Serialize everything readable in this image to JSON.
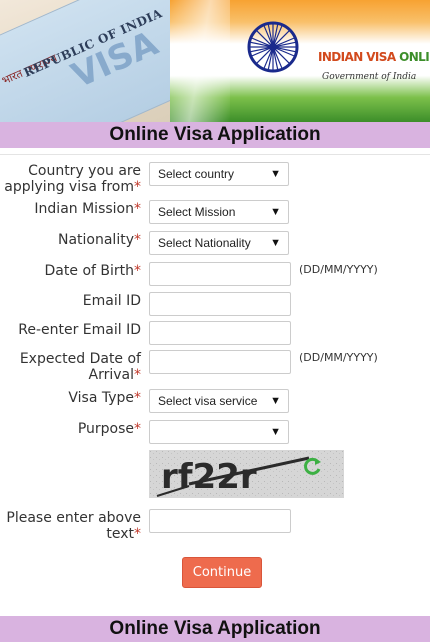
{
  "banner": {
    "card_republic": "REPUBLIC OF INDIA",
    "card_visa": "VISA",
    "card_stamp": "भारत गणराज्य",
    "brand_left": "INDIAN VISA ",
    "brand_right": "ONLINE",
    "brand_sub": "Government of India"
  },
  "page": {
    "title": "Online Visa Application",
    "footer_title": "Online Visa Application"
  },
  "form": {
    "country_label_line1": "Country you are",
    "country_label_line2": "applying visa from",
    "country_value": "Select country",
    "mission_label": "Indian Mission",
    "mission_value": "Select Mission",
    "nationality_label": "Nationality",
    "nationality_value": "Select Nationality",
    "dob_label": "Date of Birth",
    "dob_hint": "(DD/MM/YYYY)",
    "email_label": "Email ID",
    "reemail_label": "Re-enter Email ID",
    "arrival_label_line1": "Expected Date of",
    "arrival_label_line2": "Arrival",
    "arrival_hint": "(DD/MM/YYYY)",
    "visa_type_label": "Visa Type",
    "visa_type_value": "Select visa service",
    "purpose_label": "Purpose",
    "purpose_value": "",
    "captcha_text": "rf22r",
    "captcha_label_line1": "Please enter above",
    "captcha_label_line2": "text",
    "required_mark": "*",
    "dropdown_arrow": "▼",
    "continue_label": "Continue"
  }
}
